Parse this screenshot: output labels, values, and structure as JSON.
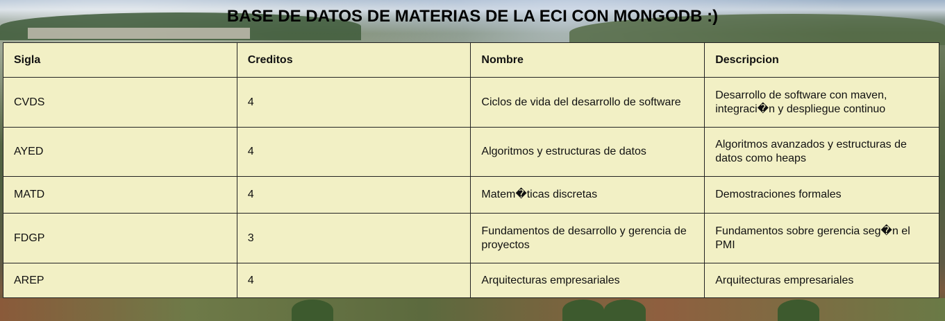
{
  "page": {
    "title": "BASE DE DATOS DE MATERIAS DE LA ECI CON MONGODB :)"
  },
  "table": {
    "headers": [
      "Sigla",
      "Creditos",
      "Nombre",
      "Descripcion"
    ],
    "rows": [
      [
        "CVDS",
        "4",
        "Ciclos de vida del desarrollo de software",
        "Desarrollo de software con maven, integraci�n y despliegue continuo"
      ],
      [
        "AYED",
        "4",
        "Algoritmos y estructuras de datos",
        "Algoritmos avanzados y estructuras de datos como heaps"
      ],
      [
        "MATD",
        "4",
        "Matem�ticas discretas",
        "Demostraciones formales"
      ],
      [
        "FDGP",
        "3",
        "Fundamentos de desarrollo y gerencia de proyectos",
        "Fundamentos sobre gerencia seg�n el PMI"
      ],
      [
        "AREP",
        "4",
        "Arquitecturas empresariales",
        "Arquitecturas empresariales"
      ]
    ]
  },
  "colors": {
    "table_background": "#f2f0c5",
    "border": "#222222",
    "text": "#111111"
  }
}
